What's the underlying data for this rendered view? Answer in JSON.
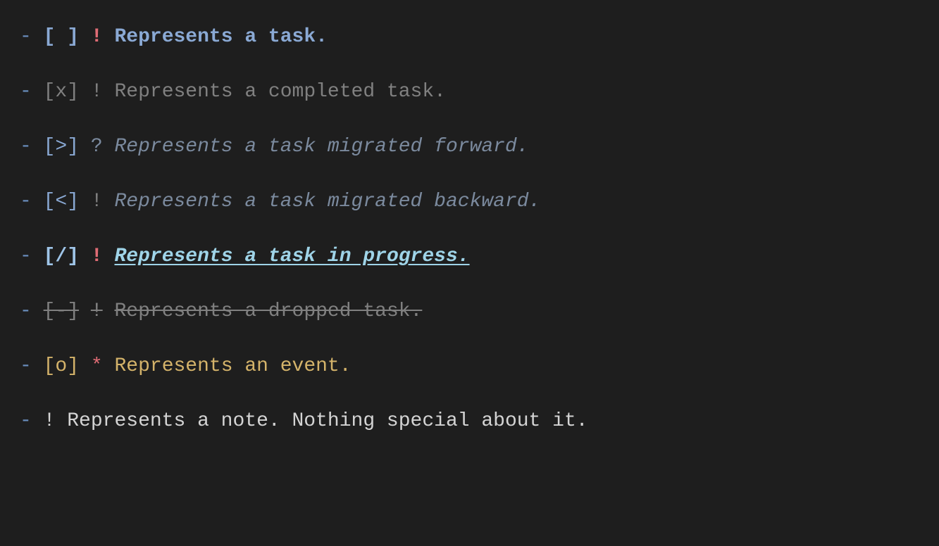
{
  "lines": [
    {
      "dash": "-",
      "checkbox": "[ ]",
      "marker": "!",
      "text": "Represents a task."
    },
    {
      "dash": "-",
      "checkbox": "[x]",
      "marker": "!",
      "text": "Represents a completed task."
    },
    {
      "dash": "-",
      "checkbox": "[>]",
      "marker": "?",
      "text": "Represents a task migrated forward."
    },
    {
      "dash": "-",
      "checkbox": "[<]",
      "marker": "!",
      "text": "Represents a task migrated backward."
    },
    {
      "dash": "-",
      "checkbox": "[/]",
      "marker": "!",
      "text": "Represents a task in progress."
    },
    {
      "dash": "-",
      "checkbox": "[-]",
      "marker": "!",
      "text": "Represents a dropped task."
    },
    {
      "dash": "-",
      "checkbox": "[o]",
      "marker": "*",
      "text": "Represents an event."
    },
    {
      "dash": "-",
      "checkbox": "",
      "marker": "!",
      "text": "Represents a note. Nothing special about it."
    }
  ]
}
